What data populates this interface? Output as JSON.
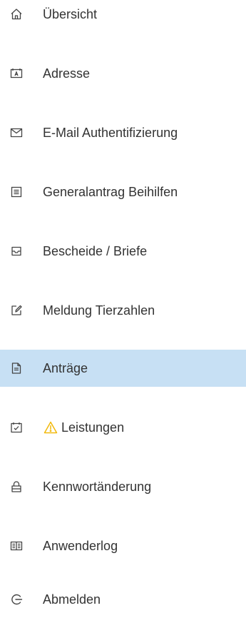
{
  "sidebar": {
    "items": [
      {
        "label": "Übersicht",
        "icon": "home-icon"
      },
      {
        "label": "Adresse",
        "icon": "address-card-icon"
      },
      {
        "label": "E-Mail Authentifizierung",
        "icon": "mail-icon"
      },
      {
        "label": "Generalantrag Beihilfen",
        "icon": "form-document-icon"
      },
      {
        "label": "Bescheide / Briefe",
        "icon": "inbox-icon"
      },
      {
        "label": "Meldung Tierzahlen",
        "icon": "edit-icon"
      },
      {
        "label": "Anträge",
        "icon": "document-icon",
        "active": true
      },
      {
        "label": "Leistungen",
        "icon": "calendar-check-icon",
        "badge_icon": "warning-icon"
      },
      {
        "label": "Kennwortänderung",
        "icon": "lock-icon"
      },
      {
        "label": "Anwenderlog",
        "icon": "book-icon"
      },
      {
        "label": "Abmelden",
        "icon": "sign-out-icon"
      }
    ]
  },
  "colors": {
    "active_background": "#c7e0f4",
    "text": "#333333",
    "icon": "#444444",
    "warning": "#f2b90c"
  }
}
